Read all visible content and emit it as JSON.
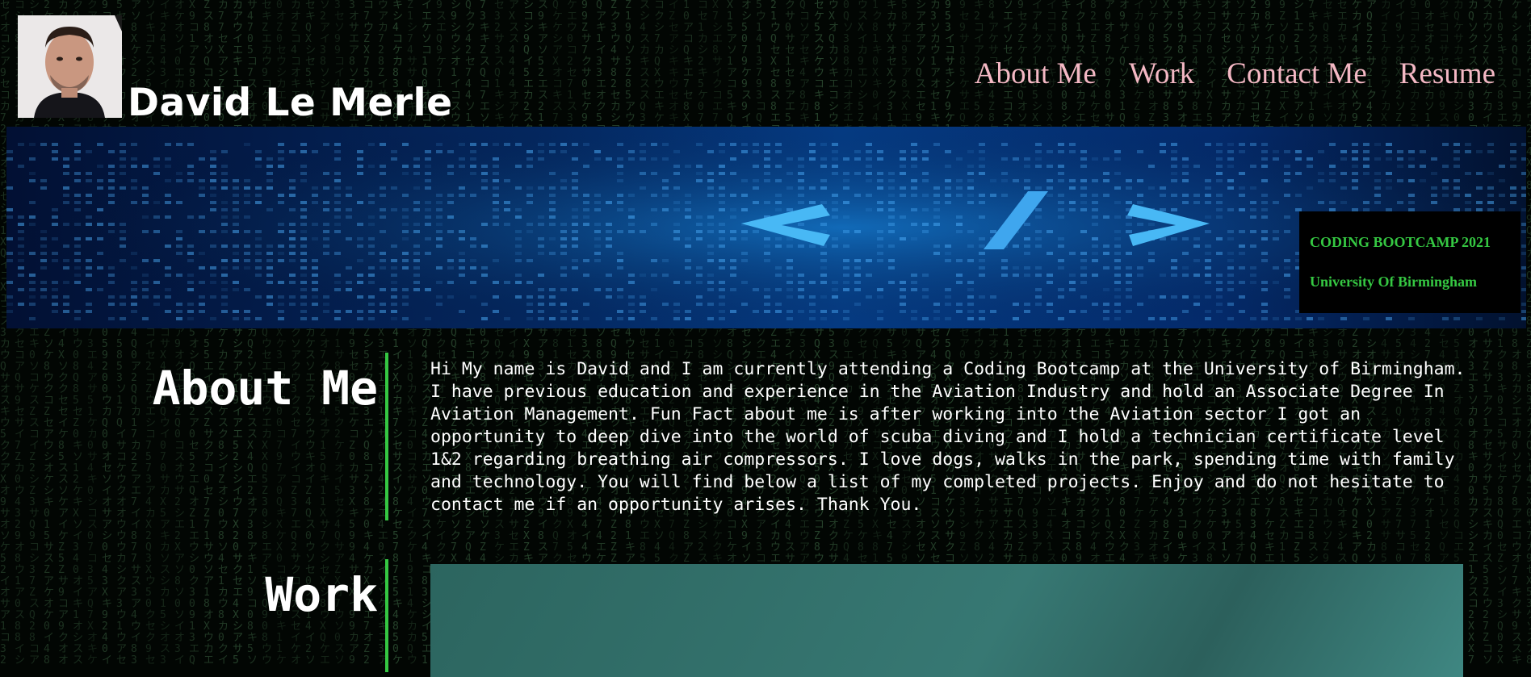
{
  "header": {
    "name": "David Le Merle",
    "nav": [
      "About Me",
      "Work",
      "Contact Me",
      "Resume"
    ]
  },
  "hero": {
    "badge_line1": "CODING BOOTCAMP 2021",
    "badge_line2": "University Of Birmingham"
  },
  "about": {
    "title": "About Me",
    "text": "Hi My name is David and I am currently attending a Coding Bootcamp at the University of Birmingham. I have previous education and experience in the Aviation Industry and hold an Associate Degree In Aviation Management. Fun Fact about me is after working into the Aviation sector I got an opportunity to deep dive into the world of scuba diving and I hold a technician certificate level 1&2 regarding breathing air compressors. I love dogs, walks in the park, spending time with family and technology. You will find below a list of my completed projects. Enjoy and do not hesitate to contact me if an opportunity arises. Thank You."
  },
  "work": {
    "title": "Work"
  },
  "colors": {
    "nav_link": "#f4b8c4",
    "accent_green": "#35c742",
    "background": "#020603"
  }
}
